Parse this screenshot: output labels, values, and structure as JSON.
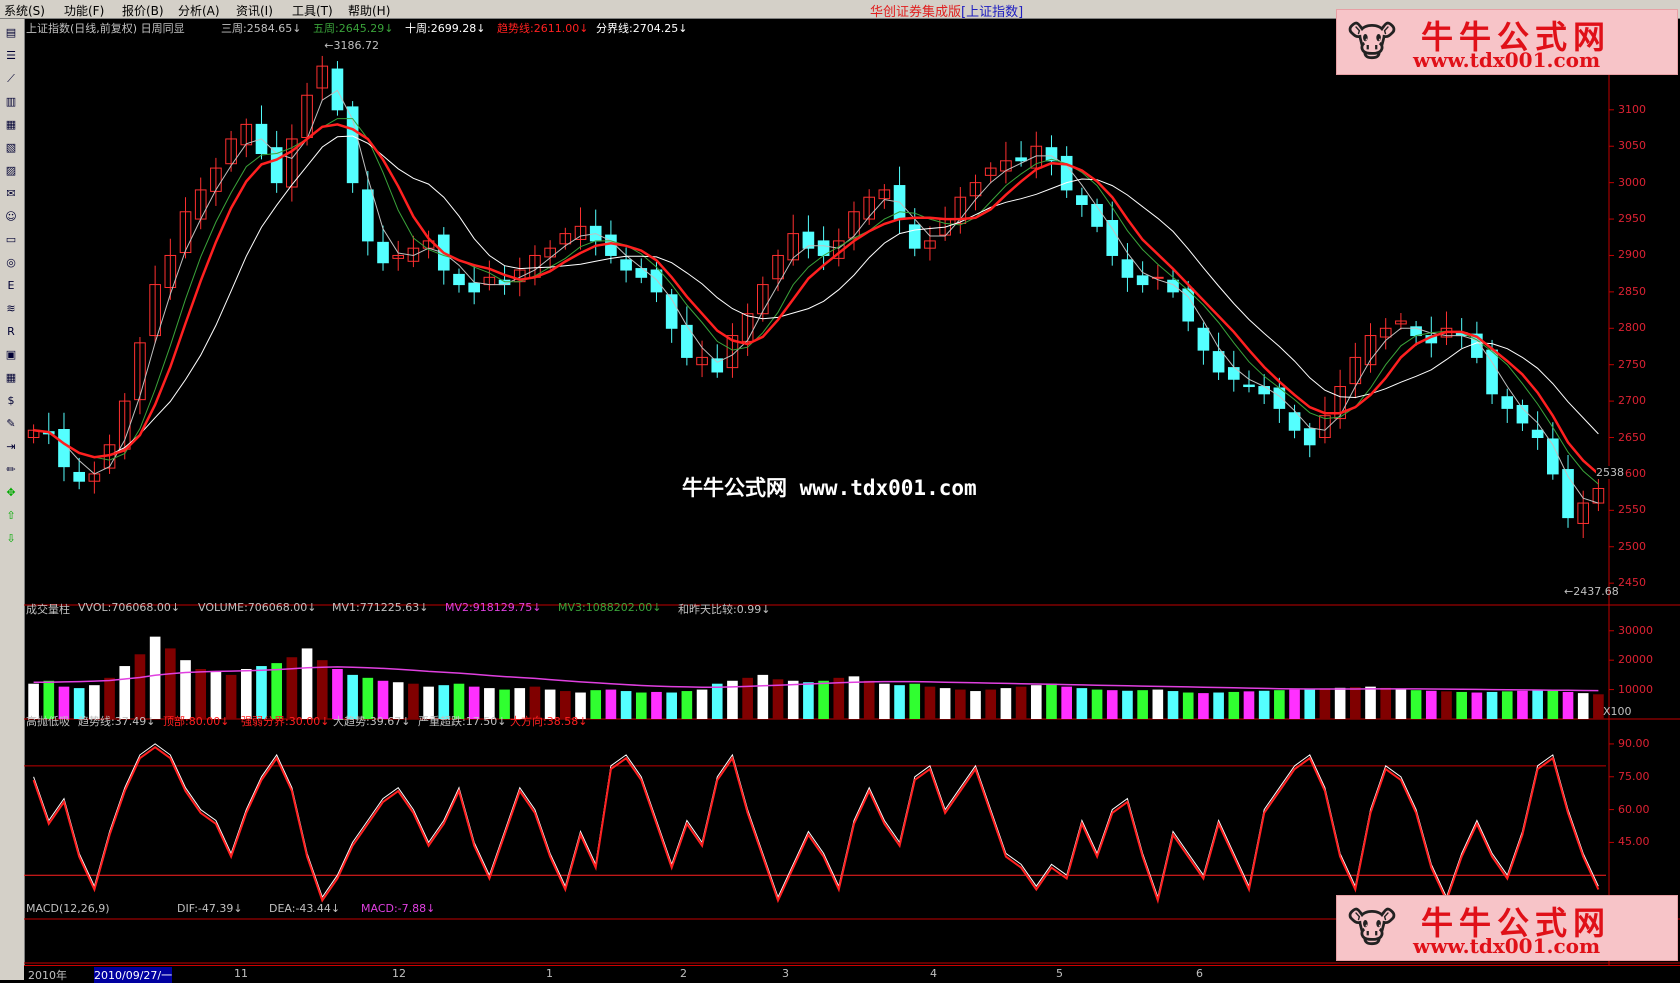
{
  "menubar": {
    "items": [
      "系统(S)",
      "功能(F)",
      "报价(B)",
      "分析(A)",
      "资讯(I)",
      "工具(T)",
      "帮助(H)"
    ],
    "title_brand": "华创证券集成版",
    "title_symbol": "[上证指数]"
  },
  "toolbar": {
    "icons": [
      "quote-icon",
      "list-icon",
      "trend-icon",
      "kline-icon",
      "table-icon",
      "sort-icon",
      "report-icon",
      "mail-icon",
      "people-icon",
      "dialog-icon",
      "globe-icon",
      "etf-icon",
      "compare-icon",
      "rsi-icon",
      "screen-icon",
      "calendar-icon",
      "money-icon",
      "wrench-icon",
      "import-icon",
      "pencil-icon",
      "move-icon",
      "up-arrow-icon",
      "down-arrow-icon"
    ]
  },
  "price_panel": {
    "header": "上证指数(日线,前复权) 日周同显",
    "indicators": [
      {
        "label": "三周:2584.65",
        "color": "#c0c0c0"
      },
      {
        "label": "五周:2645.29",
        "color": "#3aa33a"
      },
      {
        "label": "十周:2699.28",
        "color": "#ffffff"
      },
      {
        "label": "趋势线:2611.00",
        "color": "#ff2020"
      },
      {
        "label": "分界线:2704.25",
        "color": "#ffffff"
      }
    ],
    "high_label": "3186.72",
    "low_label": "2437.68",
    "last_label": "2538",
    "y_ticks": [
      "3100",
      "3050",
      "3000",
      "2950",
      "2900",
      "2850",
      "2800",
      "2750",
      "2700",
      "2650",
      "2600",
      "2550",
      "2500",
      "2450"
    ]
  },
  "volume_panel": {
    "header": "成交量柱",
    "indicators": [
      {
        "label": "VVOL:706068.00",
        "color": "#c0c0c0"
      },
      {
        "label": "VOLUME:706068.00",
        "color": "#c0c0c0"
      },
      {
        "label": "MV1:771225.63",
        "color": "#c0c0c0"
      },
      {
        "label": "MV2:918129.75",
        "color": "#e040e0"
      },
      {
        "label": "MV3:1088202.00",
        "color": "#3aa33a"
      },
      {
        "label": "和昨天比较:0.99",
        "color": "#c0c0c0"
      }
    ],
    "y_ticks": [
      "30000",
      "20000",
      "10000"
    ],
    "unit": "X100"
  },
  "osc_panel": {
    "header": "高抛低吸",
    "indicators": [
      {
        "label": "趋势线:37.49",
        "color": "#c0c0c0"
      },
      {
        "label": "顶部:80.00",
        "color": "#ff2020"
      },
      {
        "label": "强弱分界:30.00",
        "color": "#ff2020"
      },
      {
        "label": "大趋势:39.67",
        "color": "#c0c0c0"
      },
      {
        "label": "严重超跌:17.50",
        "color": "#c0c0c0"
      },
      {
        "label": "大方向:38.58",
        "color": "#ff2020"
      }
    ],
    "y_ticks": [
      "90.00",
      "75.00",
      "60.00",
      "45.00"
    ]
  },
  "macd_panel": {
    "header": "MACD(12,26,9)",
    "indicators": [
      {
        "label": "DIF:-47.39",
        "color": "#c0c0c0"
      },
      {
        "label": "DEA:-43.44",
        "color": "#c0c0c0"
      },
      {
        "label": "MACD:-7.88",
        "color": "#e040e0"
      }
    ]
  },
  "datebar": {
    "year": "2010年",
    "cursor": "2010/09/27/一",
    "months": [
      "11",
      "12",
      "1",
      "2",
      "3",
      "4",
      "5",
      "6"
    ]
  },
  "watermark": "牛牛公式网 www.tdx001.com",
  "logo": {
    "title": "牛牛公式网",
    "url": "www.tdx001.com"
  },
  "colors": {
    "up": "#ff3030",
    "down": "#54ffff",
    "trend": "#ff2020",
    "white_line": "#ffffff",
    "green_line": "#3aa33a",
    "axis": "#c00000"
  },
  "chart_data": {
    "type": "candlestick",
    "price": {
      "ylim": [
        2420,
        3200
      ],
      "closes": [
        2660,
        2655,
        2610,
        2590,
        2600,
        2640,
        2700,
        2780,
        2860,
        2900,
        2960,
        2990,
        3020,
        3060,
        3080,
        3040,
        3000,
        3060,
        3120,
        3160,
        3100,
        3000,
        2920,
        2890,
        2900,
        2910,
        2920,
        2880,
        2860,
        2850,
        2870,
        2860,
        2880,
        2900,
        2910,
        2930,
        2940,
        2920,
        2900,
        2880,
        2870,
        2850,
        2800,
        2760,
        2760,
        2740,
        2790,
        2820,
        2860,
        2900,
        2930,
        2910,
        2900,
        2920,
        2960,
        2980,
        2990,
        2950,
        2910,
        2920,
        2950,
        2980,
        3000,
        3020,
        3030,
        3030,
        3050,
        3030,
        2990,
        2970,
        2940,
        2900,
        2870,
        2860,
        2870,
        2850,
        2810,
        2770,
        2740,
        2730,
        2720,
        2710,
        2690,
        2660,
        2640,
        2680,
        2720,
        2760,
        2790,
        2800,
        2810,
        2790,
        2780,
        2800,
        2790,
        2760,
        2710,
        2690,
        2670,
        2650,
        2600,
        2540,
        2560,
        2580
      ]
    },
    "volume": {
      "ylim": [
        0,
        34000
      ],
      "values": [
        12000,
        13000,
        11000,
        10500,
        11500,
        14000,
        18000,
        22000,
        28000,
        24000,
        20000,
        17000,
        16000,
        15000,
        17000,
        18000,
        19000,
        21000,
        24000,
        20000,
        17000,
        15000,
        14000,
        13000,
        12500,
        12000,
        11000,
        11500,
        12000,
        11000,
        10500,
        10000,
        10500,
        11000,
        10000,
        9500,
        9000,
        9800,
        10000,
        9500,
        9000,
        9200,
        9000,
        9500,
        10000,
        12000,
        13000,
        14000,
        15000,
        13500,
        13000,
        12500,
        13000,
        14000,
        14500,
        13000,
        12000,
        11500,
        12000,
        11000,
        10500,
        10000,
        9500,
        10000,
        10500,
        11000,
        11500,
        12000,
        11000,
        10500,
        10000,
        9800,
        9600,
        9800,
        10000,
        9500,
        9000,
        8800,
        9000,
        9200,
        9400,
        9600,
        9800,
        10000,
        10200,
        10400,
        10600,
        10800,
        11000,
        10600,
        10200,
        9800,
        9600,
        9400,
        9200,
        9000,
        9200,
        9400,
        9600,
        9800,
        10000,
        9200,
        8800,
        8400
      ],
      "mv3": [
        12500,
        12500,
        12600,
        12700,
        12900,
        13100,
        13600,
        14100,
        14900,
        15400,
        15800,
        16000,
        16200,
        16300,
        16400,
        16600,
        16800,
        17100,
        17400,
        17600,
        17700,
        17600,
        17400,
        17200,
        16900,
        16600,
        16200,
        15900,
        15600,
        15200,
        14800,
        14400,
        14100,
        13800,
        13400,
        13000,
        12600,
        12300,
        12000,
        11700,
        11400,
        11200,
        11000,
        10900,
        10800,
        10800,
        10900,
        11100,
        11300,
        11500,
        11700,
        11900,
        12100,
        12300,
        12500,
        12600,
        12700,
        12700,
        12700,
        12600,
        12500,
        12400,
        12300,
        12200,
        12100,
        12000,
        11900,
        11800,
        11700,
        11600,
        11500,
        11400,
        11300,
        11200,
        11100,
        11000,
        10900,
        10800,
        10700,
        10600,
        10500,
        10400,
        10300,
        10250,
        10200,
        10200,
        10200,
        10200,
        10250,
        10250,
        10250,
        10250,
        10200,
        10150,
        10100,
        10050,
        10000,
        9950,
        9900,
        9850,
        9800,
        9750,
        9700,
        9650
      ]
    },
    "oscillator": {
      "ylim": [
        10,
        95
      ],
      "top_line": 80,
      "mid_line": 30,
      "values": [
        75,
        55,
        65,
        40,
        25,
        50,
        70,
        85,
        90,
        85,
        70,
        60,
        55,
        40,
        60,
        75,
        85,
        70,
        40,
        20,
        30,
        45,
        55,
        65,
        70,
        60,
        45,
        55,
        70,
        45,
        30,
        50,
        70,
        60,
        40,
        25,
        50,
        35,
        80,
        85,
        75,
        55,
        35,
        55,
        45,
        75,
        85,
        60,
        40,
        20,
        35,
        50,
        40,
        25,
        55,
        70,
        55,
        45,
        75,
        80,
        60,
        70,
        80,
        60,
        40,
        35,
        25,
        35,
        30,
        55,
        40,
        60,
        65,
        40,
        20,
        50,
        40,
        30,
        55,
        40,
        25,
        60,
        70,
        80,
        85,
        70,
        40,
        25,
        60,
        80,
        75,
        60,
        35,
        20,
        40,
        55,
        40,
        30,
        50,
        80,
        85,
        60,
        40,
        25
      ]
    }
  }
}
